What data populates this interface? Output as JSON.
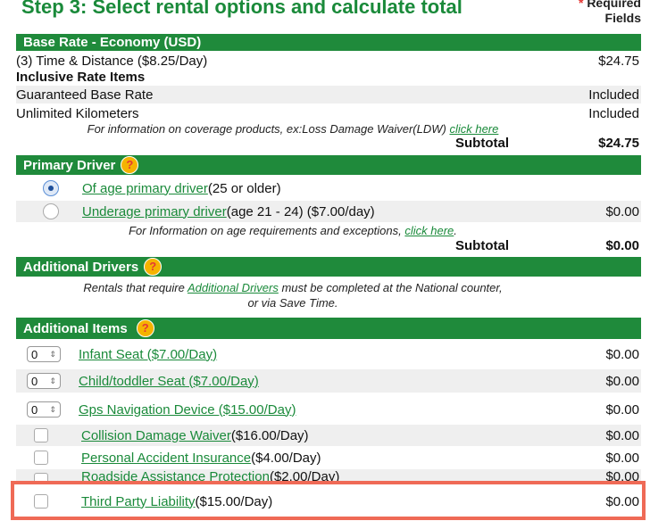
{
  "header": {
    "title": "Step 3: Select rental options and calculate total",
    "required_star": "*",
    "required_text_1": "Required",
    "required_text_2": "Fields"
  },
  "base_rate": {
    "heading": "Base Rate - Economy (USD)",
    "line_label": "(3) Time & Distance ($8.25/Day)",
    "line_price": "$24.75",
    "inclusive_heading": "Inclusive Rate Items",
    "items": [
      {
        "label": "Guaranteed Base Rate",
        "value": "Included"
      },
      {
        "label": "Unlimited Kilometers",
        "value": "Included"
      }
    ],
    "coverage_note": "For information on coverage products, ex:Loss Damage Waiver(LDW)",
    "coverage_link": "click here",
    "subtotal_label": "Subtotal",
    "subtotal_value": "$24.75"
  },
  "primary_driver": {
    "heading": "Primary Driver",
    "help_icon": "?",
    "options": [
      {
        "link": "Of age primary driver",
        "rest": " (25 or older)",
        "price": "",
        "selected": true
      },
      {
        "link": "Underage primary driver",
        "rest": " (age 21  - 24) ($7.00/day)",
        "price": "$0.00",
        "selected": false
      }
    ],
    "age_note": "For Information on age requirements and exceptions,",
    "age_link": "click here",
    "age_note_end": ".",
    "subtotal_label": "Subtotal",
    "subtotal_value": "$0.00"
  },
  "additional_drivers": {
    "heading": "Additional Drivers",
    "help_icon": "?",
    "note_1": "Rentals that require",
    "note_link": "Additional Drivers",
    "note_2": "must be completed at the National counter,",
    "note_3": "or via Save Time."
  },
  "additional_items": {
    "heading": "Additional Items",
    "help_icon": "?",
    "quantity_items": [
      {
        "qty": "0",
        "label": "Infant Seat ($7.00/Day)",
        "price": "$0.00"
      },
      {
        "qty": "0",
        "label": "Child/toddler Seat ($7.00/Day)",
        "price": "$0.00"
      },
      {
        "qty": "0",
        "label": "Gps Navigation Device ($15.00/Day)",
        "price": "$0.00"
      }
    ],
    "check_items": [
      {
        "link": "Collision Damage Waiver ",
        "rest": "($16.00/Day)",
        "price": "$0.00"
      },
      {
        "link": "Personal Accident Insurance ",
        "rest": "($4.00/Day)",
        "price": "$0.00"
      },
      {
        "link": "Roadside Assistance Protection ",
        "rest": "($2.00/Day)",
        "price": "$0.00"
      },
      {
        "link": "Third Party Liability ",
        "rest": "($15.00/Day)",
        "price": "$0.00"
      }
    ]
  },
  "colors": {
    "accent_green": "#1f8a3b",
    "highlight": "#ef6a56",
    "help_icon": "#f5b300"
  }
}
